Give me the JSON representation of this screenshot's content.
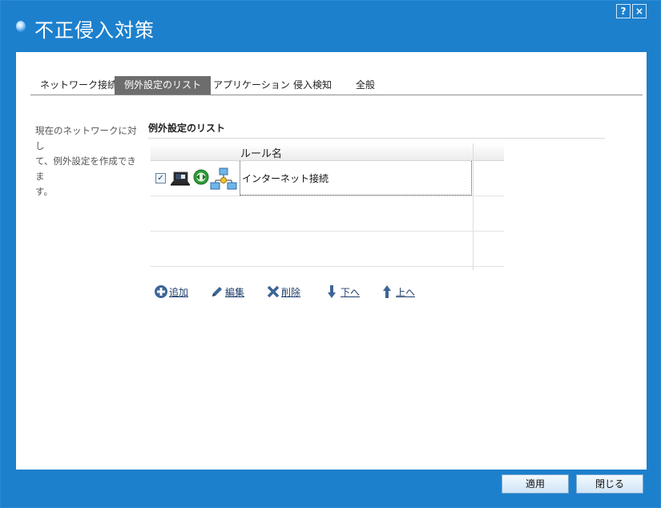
{
  "window": {
    "title": "不正侵入対策",
    "help_label": "?",
    "close_label": "×"
  },
  "tabs": [
    {
      "label": "ネットワーク接続",
      "active": false
    },
    {
      "label": "例外設定のリスト",
      "active": true
    },
    {
      "label": "アプリケーション",
      "active": false
    },
    {
      "label": "侵入検知",
      "active": false
    },
    {
      "label": "全般",
      "active": false
    }
  ],
  "sidebar": {
    "description_lines": [
      "現在のネットワークに対し",
      "て、例外設定を作成できま",
      "す。"
    ]
  },
  "section": {
    "title": "例外設定のリスト"
  },
  "grid": {
    "column_header": "ルール名",
    "rows": [
      {
        "checked": true,
        "check_glyph": "✓",
        "name": "インターネット接続",
        "icons": [
          "laptop-icon",
          "bidirectional-arrows-icon",
          "network-icon"
        ]
      }
    ]
  },
  "actions": [
    {
      "label": "追加",
      "icon": "add-icon"
    },
    {
      "label": "編集",
      "icon": "edit-icon"
    },
    {
      "label": "削除",
      "icon": "delete-icon"
    },
    {
      "label": "下へ",
      "icon": "arrow-down-icon"
    },
    {
      "label": "上へ",
      "icon": "arrow-up-icon"
    }
  ],
  "buttons": {
    "apply": "適用",
    "close": "閉じる"
  },
  "colors": {
    "window_blue": "#1d80cd",
    "active_tab": "#6d6d6d",
    "link_text": "#1e3d6b"
  }
}
